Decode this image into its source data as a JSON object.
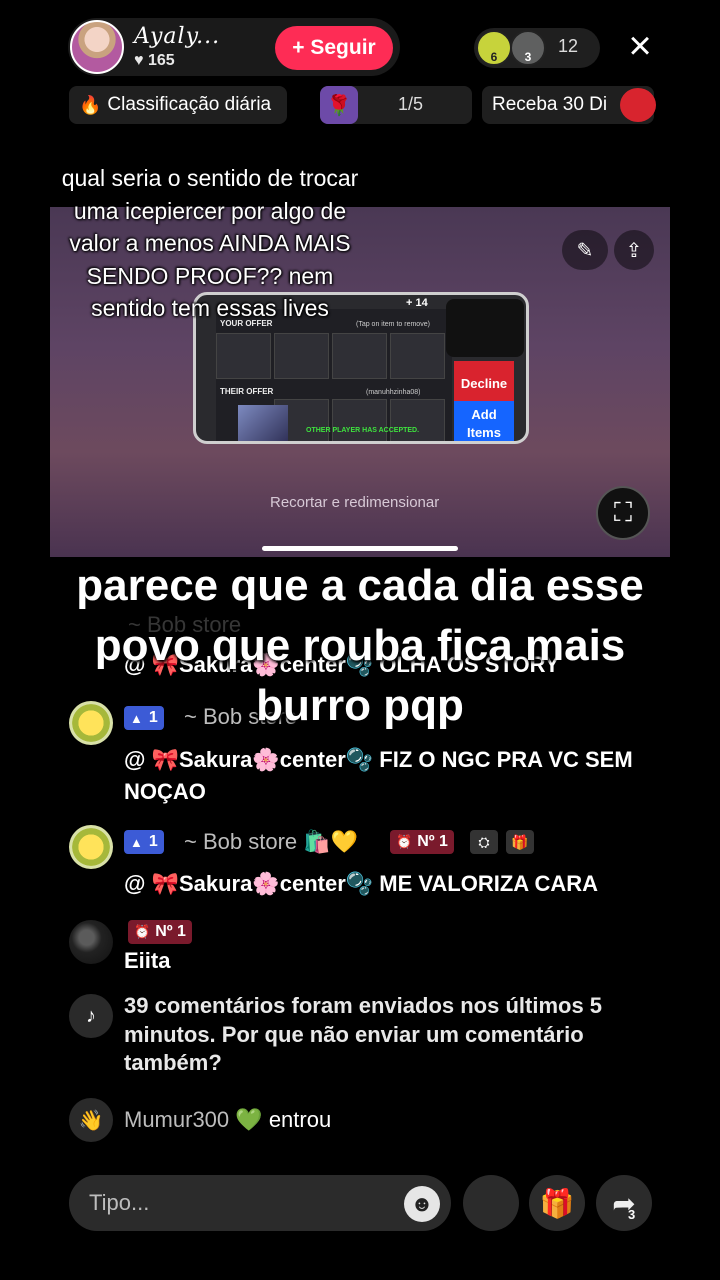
{
  "header": {
    "host_name": "Ayaly...",
    "likes": "165",
    "follow_label": "+ Seguir",
    "viewer_badges": [
      "6",
      "3"
    ],
    "viewer_count": "12",
    "close_icon": "×"
  },
  "chips": {
    "ranking_label": "Classificação diária",
    "page_indicator": "1/5",
    "gift_label": "Receba 30 Di"
  },
  "video": {
    "your_offer": "YOUR OFFER",
    "top_hint": "(Tap on item to remove)",
    "their_offer": "THEIR OFFER",
    "partner": "(manuhhzinha08)",
    "accepted": "OTHER PLAYER HAS ACCEPTED.",
    "coins": "+ 14",
    "decline_label": "Decline",
    "add_items_label": "Add Items",
    "crop_label": "Recortar e redimensionar"
  },
  "overlays": {
    "top_caption": "qual seria o sentido de trocar uma icepiercer por algo de valor a menos AINDA MAIS SENDO PROOF?? nem sentido tem essas lives",
    "big_caption": "parece que a cada dia esse povo que rouba fica mais burro pqp"
  },
  "chat": {
    "faded_header": "~ Bob store",
    "msg0": "@ 🎀Sakura🌸center🫧 OLHA OS STORY",
    "row1": {
      "level": "1",
      "username": "~ Bob store",
      "message": "@ 🎀Sakura🌸center🫧 FIZ O NGC PRA VC SEM NOÇAO"
    },
    "row2": {
      "level": "1",
      "username": "~ Bob store 🛍️💛",
      "rank": "Nº 1",
      "message": "@ 🎀Sakura🌸center🫧 ME VALORIZA CARA"
    },
    "row3": {
      "rank": "Nº 1",
      "message": "Eiita"
    },
    "system_message": "39 comentários foram enviados nos últimos 5 minutos. Por que não enviar um comentário também?",
    "join": {
      "user": "Mumur300",
      "emoji": "💚",
      "action": "entrou"
    }
  },
  "bottom": {
    "comment_placeholder": "Tipo...",
    "share_count": "3"
  }
}
